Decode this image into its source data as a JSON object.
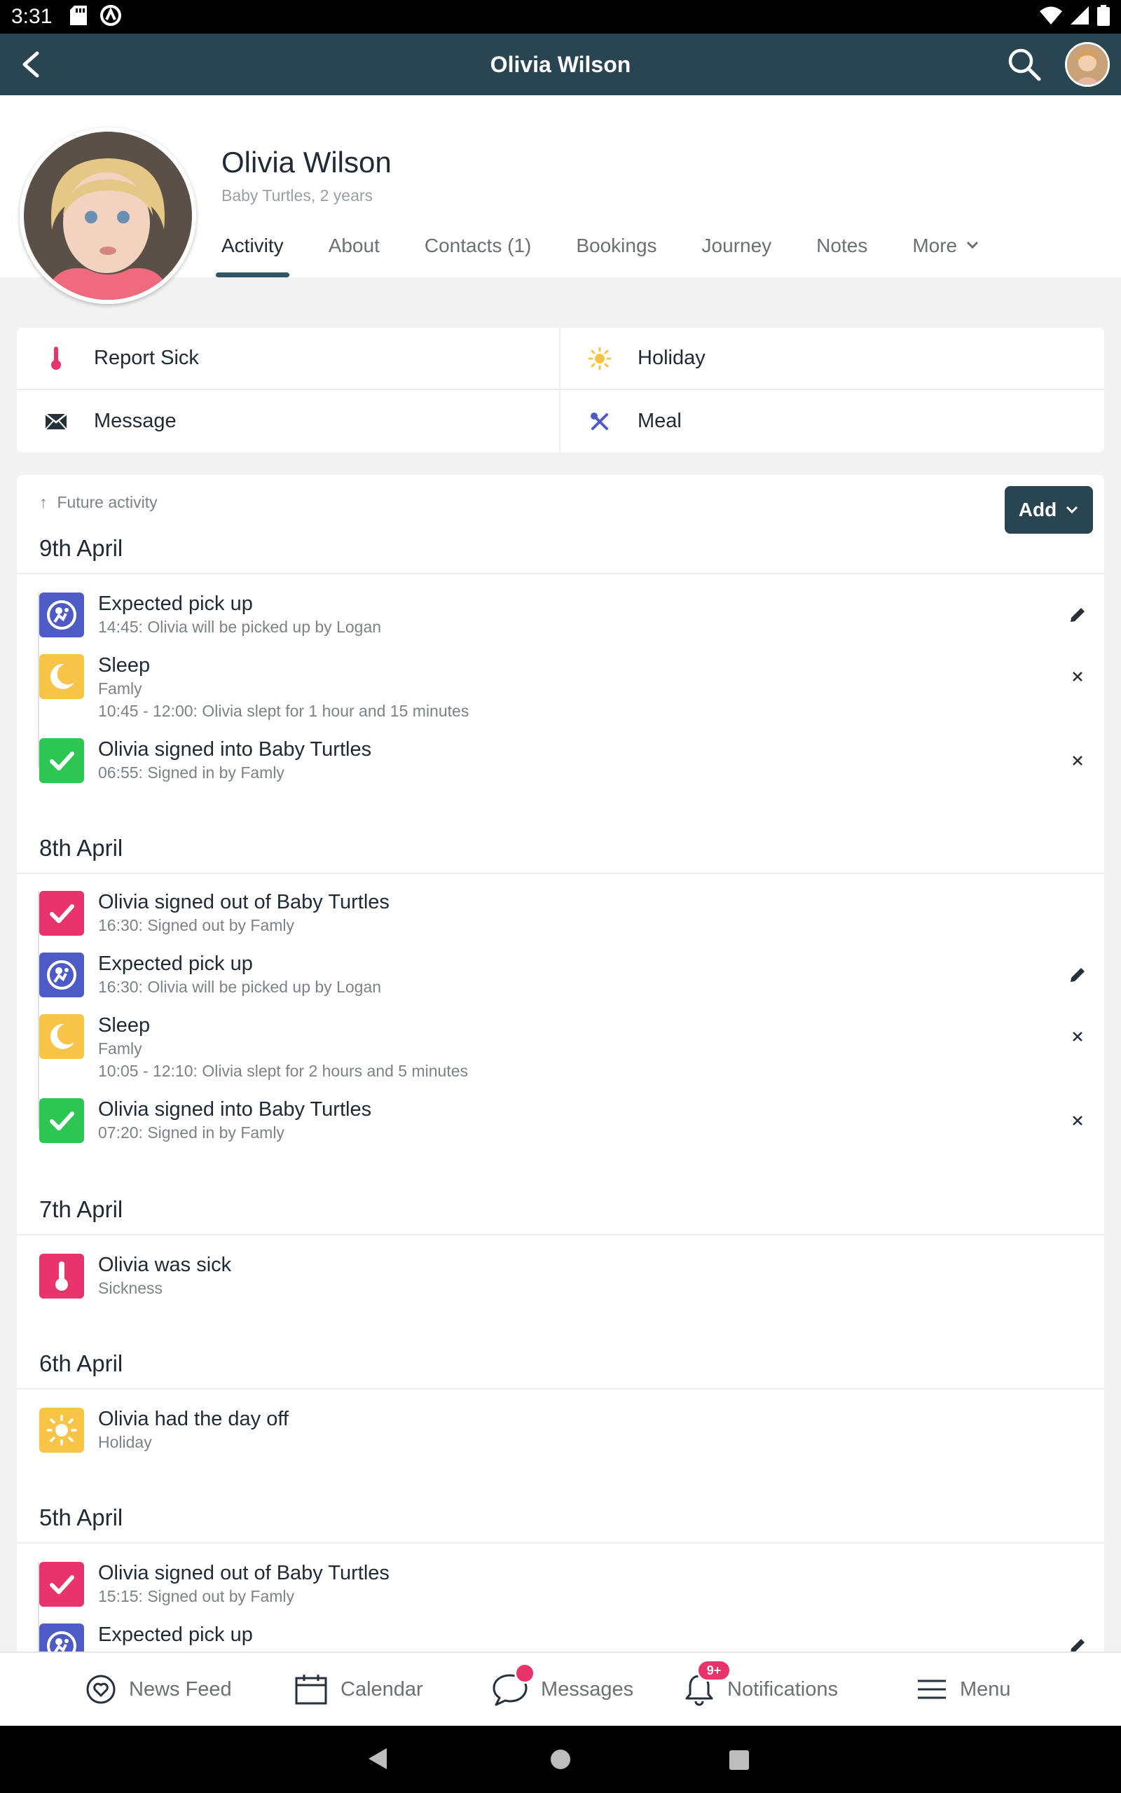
{
  "status_bar": {
    "time": "3:31"
  },
  "app_bar": {
    "title": "Olivia Wilson"
  },
  "profile": {
    "name": "Olivia Wilson",
    "subtitle": "Baby Turtles, 2 years",
    "tabs": [
      "Activity",
      "About",
      "Contacts (1)",
      "Bookings",
      "Journey",
      "Notes",
      "More"
    ]
  },
  "quick_actions": {
    "report_sick": "Report Sick",
    "holiday": "Holiday",
    "message": "Message",
    "meal": "Meal"
  },
  "activity": {
    "future_link": "Future activity",
    "add_label": "Add",
    "days": [
      {
        "date": "9th April",
        "items": [
          {
            "title": "Expected pick up",
            "lines": [
              "14:45: Olivia will be picked up by Logan"
            ]
          },
          {
            "title": "Sleep",
            "lines": [
              "Famly",
              "10:45 - 12:00: Olivia slept for 1 hour and 15 minutes"
            ]
          },
          {
            "title": "Olivia signed into Baby Turtles",
            "lines": [
              "06:55: Signed in by Famly"
            ]
          }
        ]
      },
      {
        "date": "8th April",
        "items": [
          {
            "title": "Olivia signed out of Baby Turtles",
            "lines": [
              "16:30: Signed out by Famly"
            ]
          },
          {
            "title": "Expected pick up",
            "lines": [
              "16:30: Olivia will be picked up by Logan"
            ]
          },
          {
            "title": "Sleep",
            "lines": [
              "Famly",
              "10:05 - 12:10: Olivia slept for 2 hours and 5 minutes"
            ]
          },
          {
            "title": "Olivia signed into Baby Turtles",
            "lines": [
              "07:20: Signed in by Famly"
            ]
          }
        ]
      },
      {
        "date": "7th April",
        "items": [
          {
            "title": "Olivia was sick",
            "lines": [
              "Sickness"
            ]
          }
        ]
      },
      {
        "date": "6th April",
        "items": [
          {
            "title": "Olivia had the day off",
            "lines": [
              "Holiday"
            ]
          }
        ]
      },
      {
        "date": "5th April",
        "items": [
          {
            "title": "Olivia signed out of Baby Turtles",
            "lines": [
              "15:15: Signed out by Famly"
            ]
          },
          {
            "title": "Expected pick up",
            "lines": []
          }
        ]
      }
    ]
  },
  "bottom_nav": {
    "news_feed": "News Feed",
    "calendar": "Calendar",
    "messages": "Messages",
    "notifications": "Notifications",
    "notifications_badge": "9+",
    "menu": "Menu"
  },
  "colors": {
    "app_bar": "#294552",
    "pickup": "#4f5bc4",
    "sleep": "#f8c448",
    "sign_in": "#2dc653",
    "sign_out": "#e8336b",
    "sick": "#e8336b",
    "holiday": "#f8c448"
  }
}
